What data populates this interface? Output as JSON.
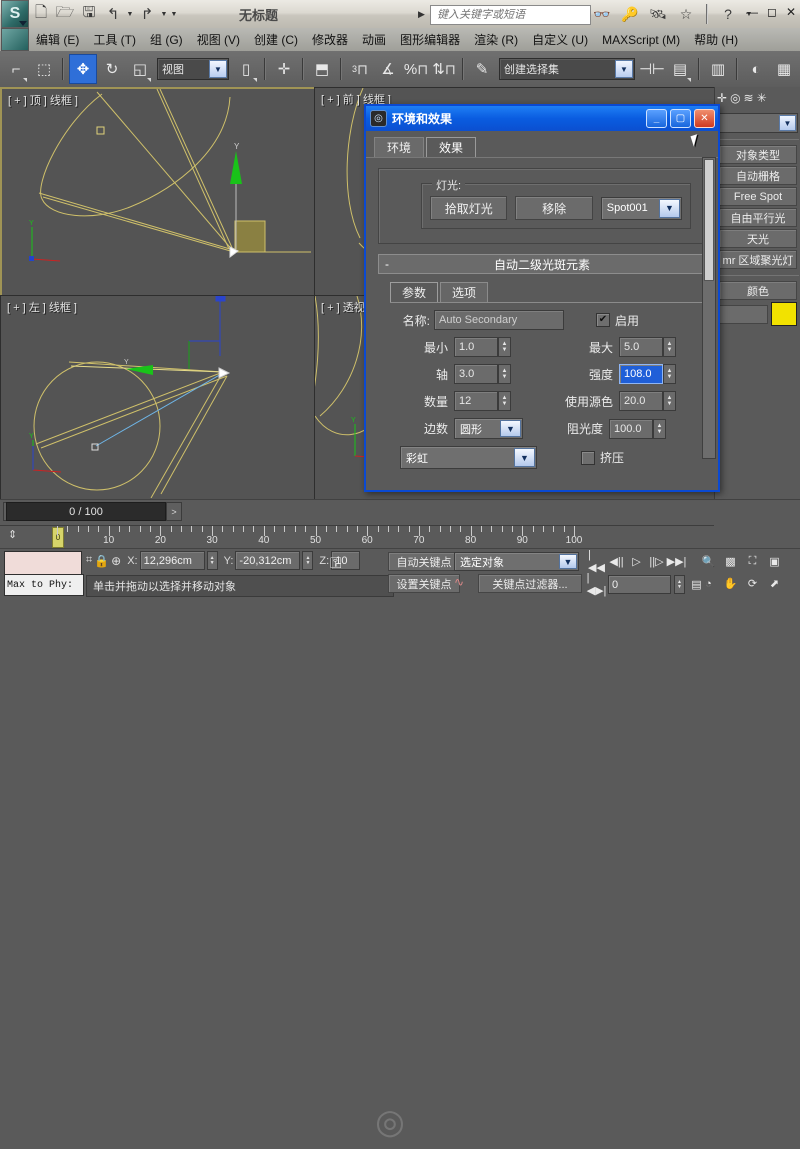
{
  "app": {
    "document_title": "无标题",
    "search_placeholder": "键入关键字或短语"
  },
  "quick_access": [
    {
      "name": "new-icon",
      "glyph": "🗋"
    },
    {
      "name": "open-icon",
      "glyph": "🗁"
    },
    {
      "name": "save-icon",
      "glyph": "🖫"
    },
    {
      "name": "undo-icon",
      "glyph": "↰"
    },
    {
      "name": "redo-icon",
      "glyph": "↱"
    }
  ],
  "titlebar_icons": [
    {
      "name": "binoculars-icon",
      "glyph": "👓"
    },
    {
      "name": "key-icon",
      "glyph": "🔑"
    },
    {
      "name": "satellite-icon",
      "glyph": "🛰"
    },
    {
      "name": "star-icon",
      "glyph": "☆"
    },
    {
      "name": "help-icon",
      "glyph": "?"
    }
  ],
  "window_buttons": {
    "minimize": "—",
    "maximize": "◻",
    "close": "✕"
  },
  "menu": {
    "items": [
      {
        "label": "编辑 (E)"
      },
      {
        "label": "工具 (T)"
      },
      {
        "label": "组 (G)"
      },
      {
        "label": "视图 (V)"
      },
      {
        "label": "创建 (C)"
      },
      {
        "label": "修改器"
      },
      {
        "label": "动画"
      },
      {
        "label": "图形编辑器"
      },
      {
        "label": "渲染 (R)"
      },
      {
        "label": "自定义 (U)"
      },
      {
        "label": "MAXScript (M)"
      },
      {
        "label": "帮助 (H)"
      }
    ]
  },
  "toolbar": {
    "reference_coord_value": "视图",
    "selection_set_value": "创建选择集",
    "snap_percent_label": "%",
    "snap_angle_label": "3",
    "buttons": [
      {
        "name": "select-object-icon",
        "glyph": "⌐"
      },
      {
        "name": "select-by-name-icon",
        "glyph": "⬚"
      },
      {
        "name": "select-and-move-icon",
        "glyph": "✥"
      },
      {
        "name": "select-and-rotate-icon",
        "glyph": "↻"
      },
      {
        "name": "select-and-scale-icon",
        "glyph": "◱"
      },
      {
        "name": "use-center-icon",
        "glyph": "⬗"
      },
      {
        "name": "mirror-icon",
        "glyph": "⇄"
      },
      {
        "name": "align-icon",
        "glyph": "⬒"
      },
      {
        "name": "named-selection-icon",
        "glyph": "✎"
      },
      {
        "name": "curve-editor-icon",
        "glyph": "⌇"
      },
      {
        "name": "schematic-view-icon",
        "glyph": "▤"
      },
      {
        "name": "material-editor-icon",
        "glyph": "◐"
      },
      {
        "name": "render-setup-icon",
        "glyph": "☀"
      },
      {
        "name": "render-frame-icon",
        "glyph": "▦"
      }
    ]
  },
  "viewports": [
    {
      "name": "viewport-top",
      "label": "[ + ] 顶 ] 线框 ]",
      "active": true
    },
    {
      "name": "viewport-front",
      "label": "[ + ] 前 ] 线框 ]",
      "active": false
    },
    {
      "name": "viewport-left",
      "label": "[ + ] 左 ] 线框 ]",
      "active": false
    },
    {
      "name": "viewport-perspective",
      "label": "[ + ] 透视 ] 线框 ]",
      "active": false
    }
  ],
  "command_panel": {
    "tab_icons": [
      {
        "name": "create-tab-icon",
        "glyph": "✛"
      },
      {
        "name": "modify-tab-icon",
        "glyph": "◎"
      },
      {
        "name": "motion-tab-icon",
        "glyph": "≋"
      },
      {
        "name": "utilities-tab-icon",
        "glyph": "✳"
      }
    ],
    "object_type_label": "对象类型",
    "auto_grid_label": "自动栅格",
    "buttons": [
      {
        "label": "Free Spot"
      },
      {
        "label": "自由平行光"
      },
      {
        "label": "天光"
      },
      {
        "label": "mr 区域聚光灯"
      }
    ],
    "color_group_label": "颜色",
    "color_swatch": "#f2e200"
  },
  "timeline": {
    "slider_value": "0 / 100",
    "prev_arrow": "<",
    "next_arrow": ">",
    "ruler_labels": [
      "10",
      "20",
      "30",
      "40",
      "50",
      "60",
      "70",
      "80",
      "90",
      "100"
    ]
  },
  "status_bar": {
    "max_to_phy_label": "Max to Phy:",
    "prompt": "单击并拖动以选择并移动对象",
    "coords": [
      {
        "axis": "X:",
        "value": "12,296cm"
      },
      {
        "axis": "Y:",
        "value": "-20,312cm"
      },
      {
        "axis": "Z:",
        "value": "10"
      }
    ],
    "auto_key_label": "自动关键点",
    "set_key_label": "设置关键点",
    "key_mode_value": "选定对象",
    "key_filters_label": "关键点过滤器...",
    "frame_field": "0",
    "playback_icons": [
      {
        "name": "goto-start-icon",
        "glyph": "|◀◀"
      },
      {
        "name": "prev-frame-icon",
        "glyph": "◀||"
      },
      {
        "name": "play-icon",
        "glyph": "▷"
      },
      {
        "name": "next-frame-icon",
        "glyph": "||▷"
      },
      {
        "name": "goto-end-icon",
        "glyph": "▶▶|"
      }
    ],
    "nav_icons": [
      {
        "name": "zoom-icon",
        "glyph": "🔍"
      },
      {
        "name": "zoom-all-icon",
        "glyph": "▩"
      },
      {
        "name": "zoom-extents-icon",
        "glyph": "⛶"
      },
      {
        "name": "zoom-extents-all-icon",
        "glyph": "▣"
      },
      {
        "name": "field-of-view-icon",
        "glyph": "◔"
      },
      {
        "name": "pan-icon",
        "glyph": "✋"
      },
      {
        "name": "orbit-icon",
        "glyph": "⟳"
      },
      {
        "name": "maximize-viewport-icon",
        "glyph": "⬈"
      }
    ]
  },
  "dialog": {
    "title": "环境和效果",
    "icon": "◎",
    "tabs": [
      {
        "label": "环境",
        "active": false
      },
      {
        "label": "效果",
        "active": true
      }
    ],
    "lights_group": {
      "caption": "灯光:",
      "pick_light_label": "拾取灯光",
      "remove_label": "移除",
      "light_value": "Spot001"
    },
    "rollout": {
      "collapse_glyph": "-",
      "title": "自动二级光斑元素"
    },
    "param_tabs": [
      {
        "label": "参数",
        "active": true
      },
      {
        "label": "选项",
        "active": false
      }
    ],
    "params": {
      "name_label": "名称:",
      "name_value": "Auto Secondary",
      "enable_label": "启用",
      "enable_checked": true,
      "min_label": "最小",
      "min_value": "1.0",
      "max_label": "最大",
      "max_value": "5.0",
      "axis_label": "轴",
      "axis_value": "3.0",
      "intensity_label": "强度",
      "intensity_value": "108.0",
      "quantity_label": "数量",
      "quantity_value": "12",
      "use_source_color_label": "使用源色",
      "use_source_color_value": "20.0",
      "sides_label": "边数",
      "sides_value": "圆形",
      "occlusion_label": "阻光度",
      "occlusion_value": "100.0",
      "gradient_value": "彩虹",
      "squeeze_label": "挤压",
      "squeeze_checked": false
    }
  }
}
